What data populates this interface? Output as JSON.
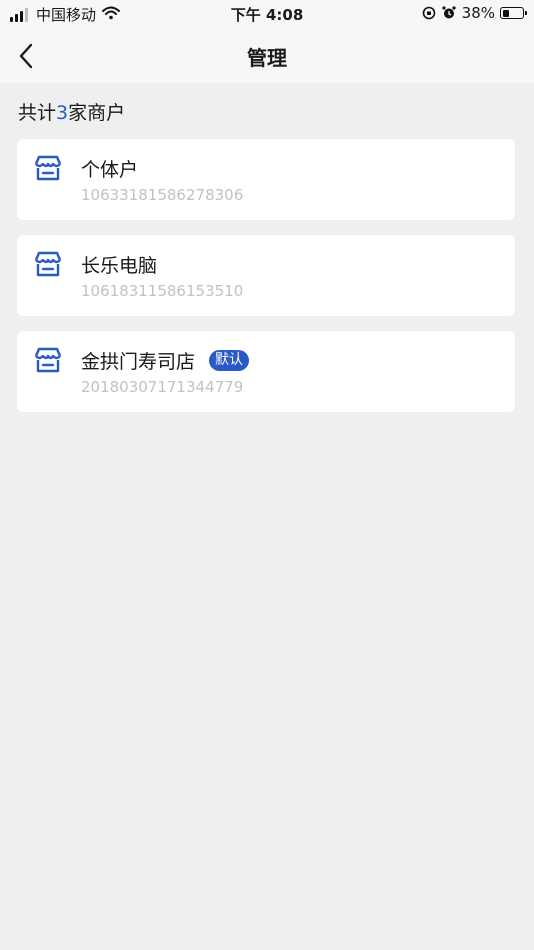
{
  "status_bar": {
    "carrier": "中国移动",
    "time": "下午 4:08",
    "battery": "38%",
    "battery_level": 0.38
  },
  "nav": {
    "title": "管理"
  },
  "summary": {
    "prefix": "共计",
    "count": "3",
    "suffix": "家商户"
  },
  "merchants": [
    {
      "name": "个体户",
      "id": "10633181586278306",
      "badge": ""
    },
    {
      "name": "长乐电脑",
      "id": "10618311586153510",
      "badge": ""
    },
    {
      "name": "金拱门寿司店",
      "id": "20180307171344779",
      "badge": "默认"
    }
  ],
  "colors": {
    "accent": "#2a5ac8",
    "background": "#efefef",
    "card": "#ffffff",
    "secondary_text": "#c2c2c2"
  }
}
